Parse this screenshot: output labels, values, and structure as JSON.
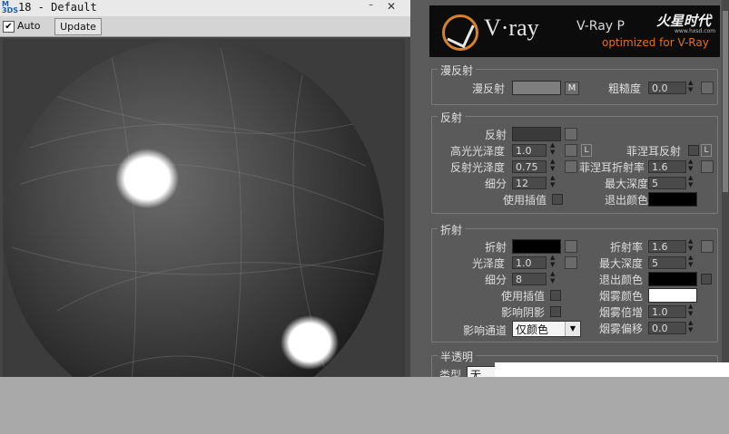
{
  "preview": {
    "title": "18 - Default",
    "app_icon_text": "M\n3DS",
    "minimize_glyph": "–",
    "close_glyph": "✕",
    "auto_label": "Auto",
    "auto_checked": "✔",
    "update_label": "Update"
  },
  "banner": {
    "wordmark": "V·ray",
    "title": "V-Ray P",
    "subtitle": "optimized for V-Ray",
    "watermark": "火星时代",
    "watermark_url": "www.hxsd.com"
  },
  "diffuse": {
    "title": "漫反射",
    "diffuse_label": "漫反射",
    "diffuse_color": "#7e7e7e",
    "m_button": "M",
    "roughness_label": "粗糙度",
    "roughness_value": "0.0"
  },
  "reflection": {
    "title": "反射",
    "reflect_label": "反射",
    "reflect_color": "#3a3a3a",
    "hilight_gloss_label": "高光光泽度",
    "hilight_gloss_value": "1.0",
    "l_button": "L",
    "fresnel_label": "菲涅耳反射",
    "fresnel_l_button": "L",
    "refl_gloss_label": "反射光泽度",
    "refl_gloss_value": "0.75",
    "fresnel_ior_label": "菲涅耳折射率",
    "fresnel_ior_value": "1.6",
    "subdivs_label": "细分",
    "subdivs_value": "12",
    "max_depth_label": "最大深度",
    "max_depth_value": "5",
    "use_interp_label": "使用插值",
    "exit_color_label": "退出颜色",
    "exit_color": "#000000"
  },
  "refraction": {
    "title": "折射",
    "refract_label": "折射",
    "refract_color": "#000000",
    "ior_label": "折射率",
    "ior_value": "1.6",
    "gloss_label": "光泽度",
    "gloss_value": "1.0",
    "max_depth_label": "最大深度",
    "max_depth_value": "5",
    "subdivs_label": "细分",
    "subdivs_value": "8",
    "exit_color_label": "退出颜色",
    "exit_color": "#000000",
    "use_interp_label": "使用插值",
    "fog_color_label": "烟雾颜色",
    "fog_color": "#ffffff",
    "affect_shadows_label": "影响阴影",
    "fog_mult_label": "烟雾倍增",
    "fog_mult_value": "1.0",
    "affect_channels_label": "影响通道",
    "affect_channels_value": "仅颜色",
    "dropdown_arrow": "▼",
    "fog_bias_label": "烟雾偏移",
    "fog_bias_value": "0.0"
  },
  "translucency": {
    "title": "半透明",
    "type_label": "类型",
    "type_value": "无"
  }
}
